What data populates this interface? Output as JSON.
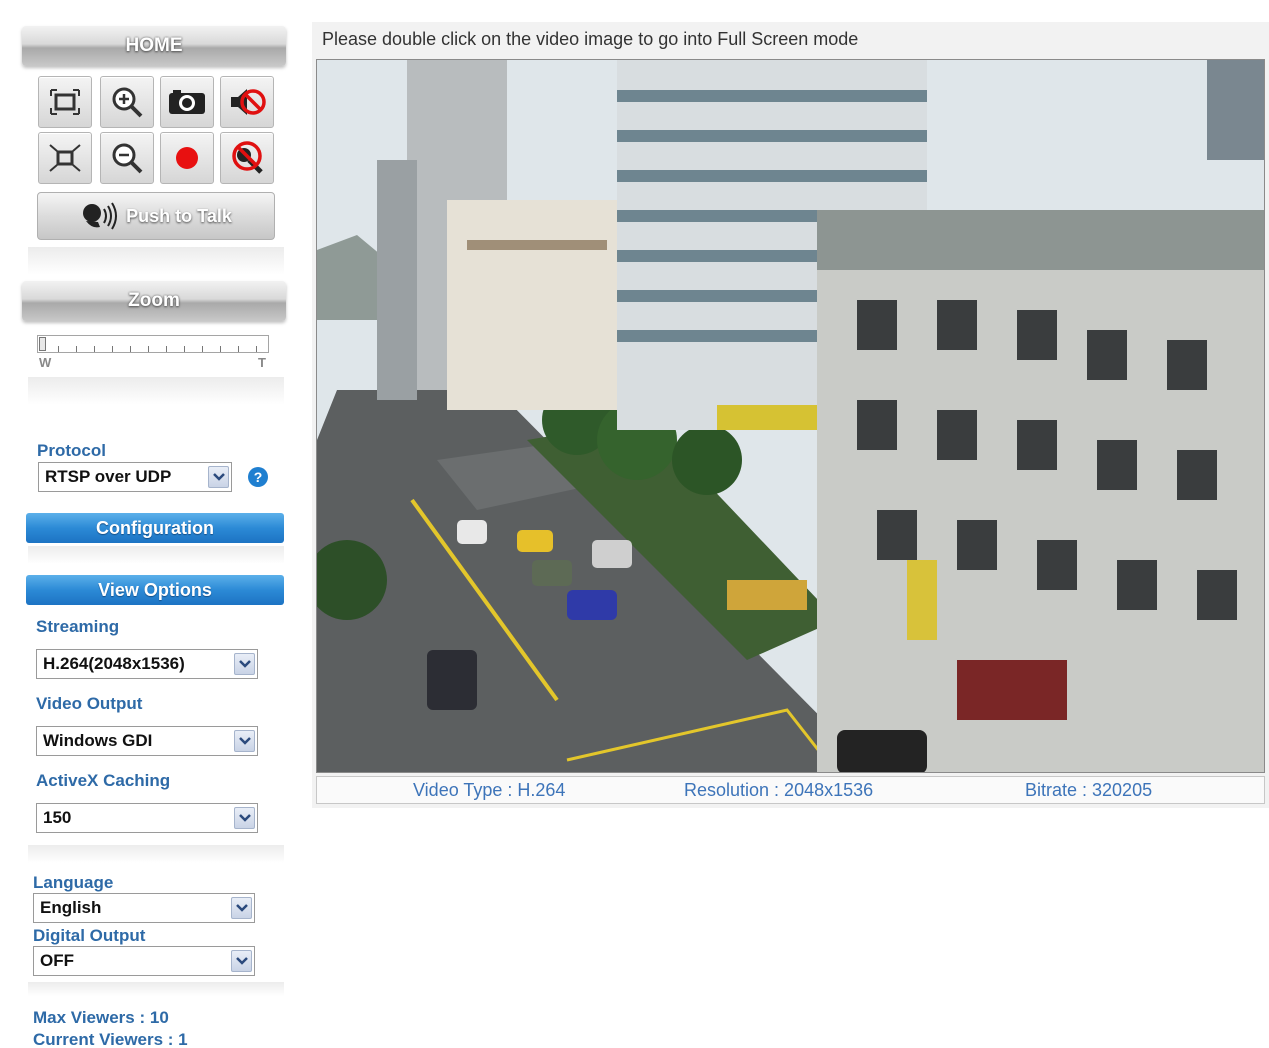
{
  "sidebar": {
    "home_title": "HOME",
    "controls": [
      {
        "name": "fullscreen-icon",
        "label": ""
      },
      {
        "name": "zoom-in-icon",
        "label": ""
      },
      {
        "name": "snapshot-camera-icon",
        "label": ""
      },
      {
        "name": "speaker-mute-icon",
        "label": ""
      },
      {
        "name": "fit-window-icon",
        "label": ""
      },
      {
        "name": "zoom-out-icon",
        "label": ""
      },
      {
        "name": "record-icon",
        "label": ""
      },
      {
        "name": "microphone-mute-icon",
        "label": ""
      }
    ],
    "push_to_talk_label": "Push to Talk",
    "zoom_title": "Zoom",
    "zoom_wide_label": "W",
    "zoom_tele_label": "T",
    "zoom_level": 0,
    "protocol_label": "Protocol",
    "protocol_value": "RTSP over UDP",
    "configuration_label": "Configuration",
    "view_options_label": "View Options",
    "streaming_label": "Streaming",
    "streaming_value": "H.264(2048x1536)",
    "video_output_label": "Video Output",
    "video_output_value": "Windows GDI",
    "activex_caching_label": "ActiveX Caching",
    "activex_caching_value": "150",
    "language_label": "Language",
    "language_value": "English",
    "digital_output_label": "Digital Output",
    "digital_output_value": "OFF",
    "max_viewers_text": "Max Viewers :  10",
    "current_viewers_text": "Current Viewers :  1"
  },
  "main": {
    "hint_text": "Please double click on the video image to go into Full Screen mode",
    "video_type_text": "Video Type :  H.264",
    "resolution_text": "Resolution :  2048x1536",
    "bitrate_text": "Bitrate :  320205"
  },
  "colors": {
    "accent_blue": "#2c8ad6",
    "label_blue": "#2e6aa7",
    "info_blue": "#3d74b9"
  }
}
